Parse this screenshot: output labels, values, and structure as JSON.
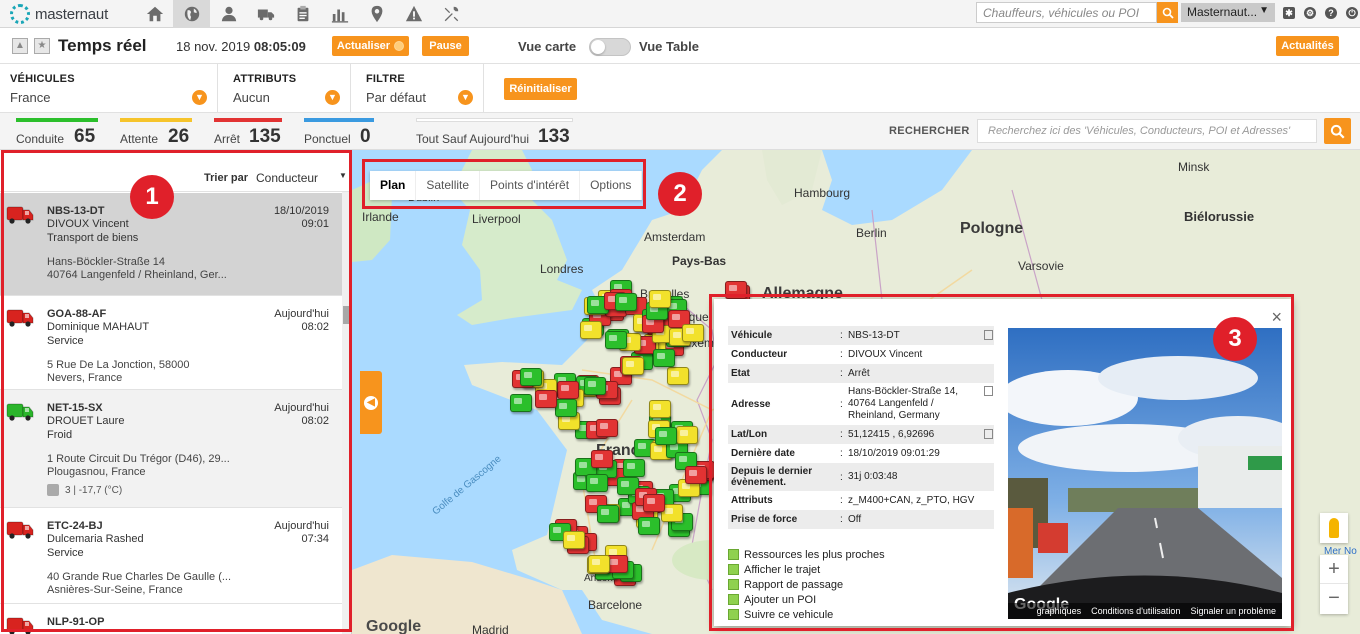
{
  "brand": {
    "logo_text": "masternaut"
  },
  "topnav": {
    "icons": [
      "home-icon",
      "globe-icon",
      "user-icon",
      "truck-icon",
      "clipboard-icon",
      "bar-chart-icon",
      "map-pin-icon",
      "warning-icon",
      "tools-icon"
    ],
    "search_placeholder": "Chauffeurs, véhicules ou POI",
    "user_menu": "Masternaut..."
  },
  "header": {
    "title": "Temps réel",
    "date": "18 nov. 2019",
    "time": "08:05:09",
    "refresh_label": "Actualiser",
    "pause_label": "Pause",
    "view_map_label": "Vue carte",
    "view_table_label": "Vue Table",
    "news_label": "Actualités"
  },
  "filters": [
    {
      "label": "VÉHICULES",
      "value": "France"
    },
    {
      "label": "ATTRIBUTS",
      "value": "Aucun"
    },
    {
      "label": "FILTRE",
      "value": "Par défaut"
    }
  ],
  "reset_label": "Réinitialiser",
  "status": [
    {
      "label": "Conduite",
      "count": "65",
      "color": "#2bbf2b"
    },
    {
      "label": "Attente",
      "count": "26",
      "color": "#f6c42b"
    },
    {
      "label": "Arrêt",
      "count": "135",
      "color": "#e23333"
    },
    {
      "label": "Ponctuel",
      "count": "0",
      "color": "#3a9ae0"
    },
    {
      "label": "Tout Sauf Aujourd'hui",
      "count": "133",
      "color": "#ffffff"
    }
  ],
  "search": {
    "label": "RECHERCHER",
    "placeholder": "Recherchez ici des 'Véhicules, Conducteurs, POI et Adresses'"
  },
  "list": {
    "sort_label": "Trier par",
    "sort_value": "Conducteur",
    "items": [
      {
        "plate": "NBS-13-DT",
        "driver": "DIVOUX Vincent",
        "activity": "Transport de biens",
        "addr1": "Hans-Böckler-Straße 14",
        "addr2": "40764 Langenfeld / Rheinland, Ger...",
        "date": "18/10/2019",
        "time": "09:01",
        "status_color": "#d8231f"
      },
      {
        "plate": "GOA-88-AF",
        "driver": "Dominique MAHAUT",
        "activity": "Service",
        "addr1": "5 Rue De La Jonction, 58000",
        "addr2": "Nevers, France",
        "date": "Aujourd'hui",
        "time": "08:02",
        "status_color": "#d8231f"
      },
      {
        "plate": "NET-15-SX",
        "driver": "DROUET Laure",
        "activity": "Froid",
        "addr1": "1 Route Circuit Du Trégor (D46), 29...",
        "addr2": "Plougasnou, France",
        "date": "Aujourd'hui",
        "time": "08:02",
        "status_color": "#2bb52b",
        "temp": "3 | -17,7 (°C)"
      },
      {
        "plate": "ETC-24-BJ",
        "driver": "Dulcemaria Rashed",
        "activity": "Service",
        "addr1": "40 Grande Rue Charles De Gaulle (...",
        "addr2": "Asnières-Sur-Seine, France",
        "date": "Aujourd'hui",
        "time": "07:34",
        "status_color": "#d8231f"
      },
      {
        "plate": "NLP-91-OP",
        "driver": "",
        "activity": "",
        "addr1": "",
        "addr2": "",
        "date": "",
        "time": "",
        "status_color": "#d8231f"
      }
    ]
  },
  "map": {
    "map_types": [
      "Plan",
      "Satellite",
      "Points d'intérêt",
      "Options"
    ],
    "selected_map_type": "Plan",
    "places": [
      "Irlande",
      "Dublin",
      "Liverpool",
      "Londres",
      "Amsterdam",
      "Pays-Bas",
      "Bruxelles",
      "Belgique",
      "Luxembourg",
      "Allemagne",
      "Hambourg",
      "Berlin",
      "Pologne",
      "Varsovie",
      "Minsk",
      "Biélorussie",
      "France",
      "Golfe de Gascogne",
      "Andorre",
      "Barcelone",
      "Madrid",
      "Mer No"
    ],
    "google_label": "Google"
  },
  "popup": {
    "rows": [
      {
        "key": "Véhicule",
        "value": "NBS-13-DT",
        "copy": true
      },
      {
        "key": "Conducteur",
        "value": "DIVOUX Vincent",
        "copy": false
      },
      {
        "key": "Etat",
        "value": "Arrêt",
        "copy": false
      },
      {
        "key": "Adresse",
        "value": "Hans-Böckler-Straße 14, 40764 Langenfeld / Rheinland, Germany",
        "copy": true
      },
      {
        "key": "Lat/Lon",
        "value": "51,12415 , 6,92696",
        "copy": true
      },
      {
        "key": "Dernière date",
        "value": "18/10/2019 09:01:29",
        "copy": false
      },
      {
        "key": "Depuis le dernier évènement.",
        "value": "31j 0:03:48",
        "copy": false
      },
      {
        "key": "Attributs",
        "value": "z_M400+CAN, z_PTO, HGV",
        "copy": false
      },
      {
        "key": "Prise de force",
        "value": "Off",
        "copy": false
      }
    ],
    "actions": [
      "Ressources les plus proches",
      "Afficher le trajet",
      "Rapport de passage",
      "Ajouter un POI",
      "Suivre ce vehicule"
    ],
    "photo_footer": [
      "graphiques",
      "Conditions d'utilisation",
      "Signaler un problème"
    ],
    "photo_google": "Google",
    "close": "×"
  },
  "annotations": [
    "1",
    "2",
    "3"
  ]
}
